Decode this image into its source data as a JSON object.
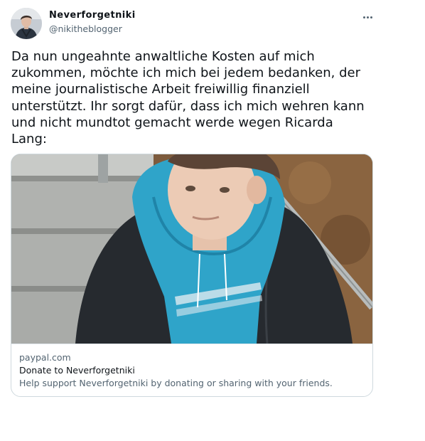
{
  "author": {
    "display_name": "Neverforgetniki",
    "handle": "@nikitheblogger",
    "avatar_icon": "avatar-photo"
  },
  "more_icon": "more-horizontal-icon",
  "tweet": {
    "text": "Da nun ungeahnte anwaltliche Kosten auf mich zukommen, möchte ich mich bei jedem bedanken, der meine journalistische Arbeit freiwillig finanziell unterstützt. Ihr sorgt dafür, dass ich mich wehren kann und nicht mundtot gemacht werde wegen Ricarda Lang:"
  },
  "card": {
    "domain": "paypal.com",
    "title": "Donate to Neverforgetniki",
    "description": "Help support Neverforgetniki by donating or sharing with your friends."
  },
  "colors": {
    "text_primary": "#0f1419",
    "text_secondary": "#536471",
    "border": "#cfd9de",
    "hoodie": "#2fa4c9"
  }
}
